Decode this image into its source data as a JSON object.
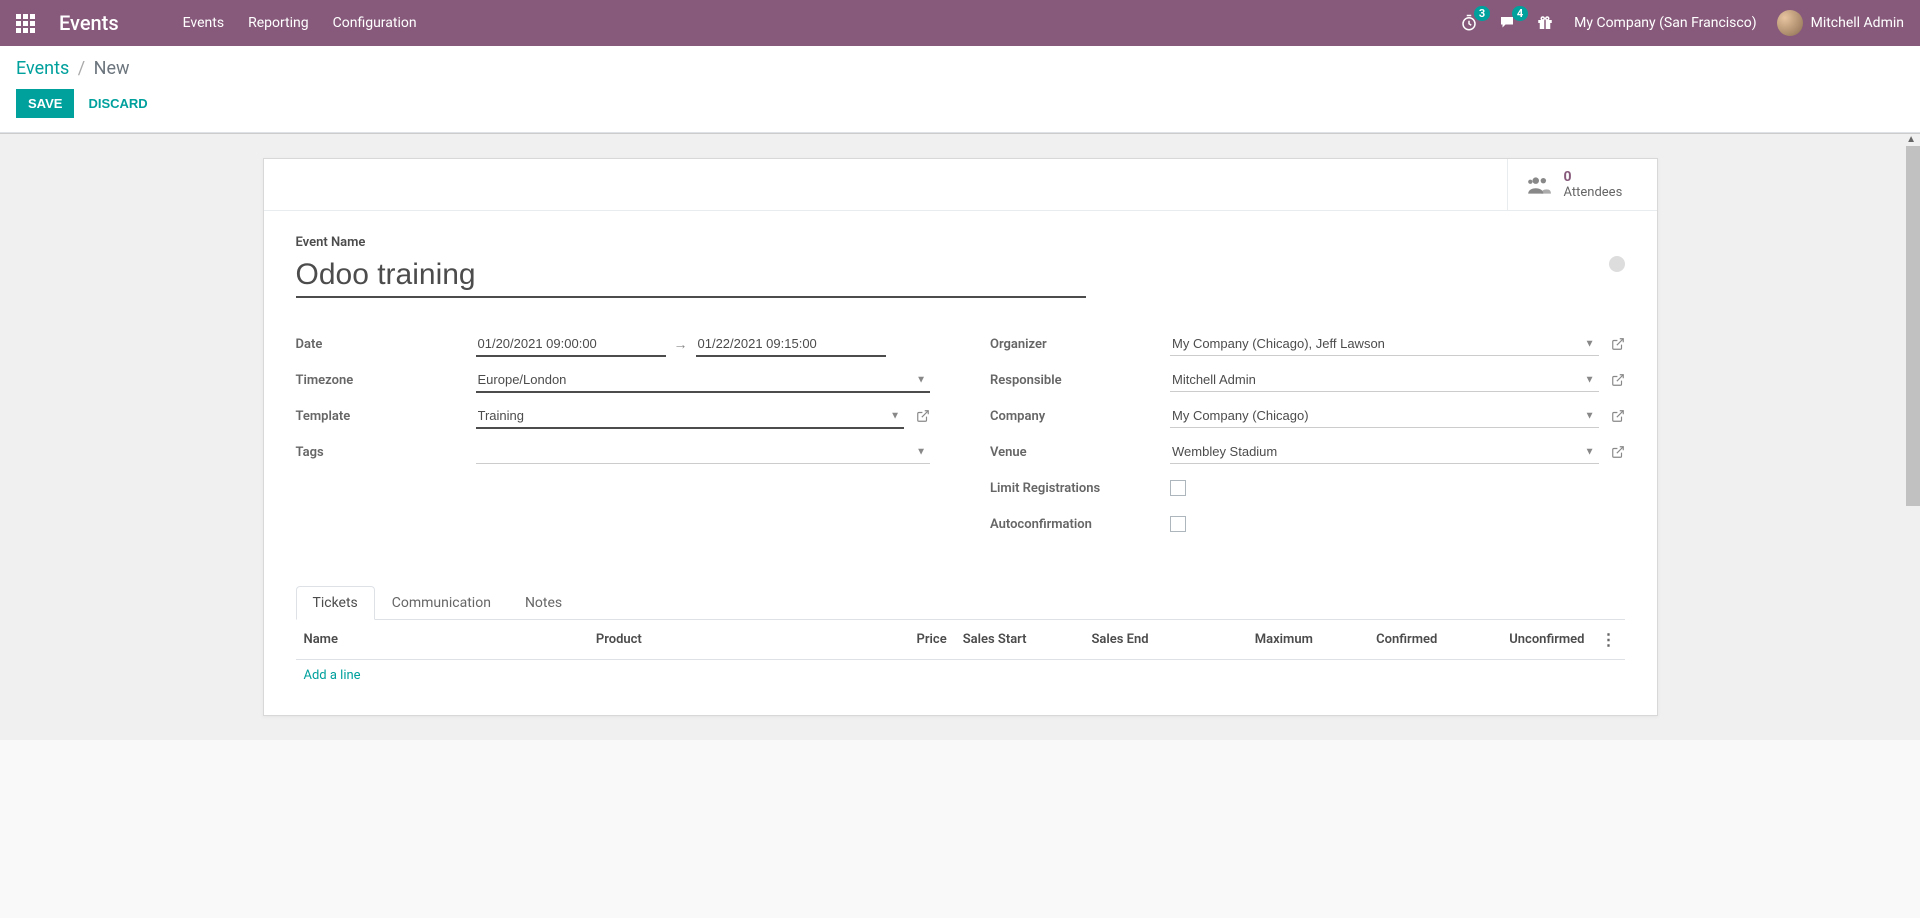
{
  "navbar": {
    "brand": "Events",
    "menu": [
      "Events",
      "Reporting",
      "Configuration"
    ],
    "timer_badge": "3",
    "chat_badge": "4",
    "company": "My Company (San Francisco)",
    "user": "Mitchell Admin"
  },
  "breadcrumb": {
    "root": "Events",
    "active": "New"
  },
  "actions": {
    "save": "Save",
    "discard": "Discard"
  },
  "stats": {
    "attendees_count": "0",
    "attendees_label": "Attendees"
  },
  "form": {
    "event_name_label": "Event Name",
    "event_name": "Odoo training",
    "labels": {
      "date": "Date",
      "timezone": "Timezone",
      "template": "Template",
      "tags": "Tags",
      "organizer": "Organizer",
      "responsible": "Responsible",
      "company": "Company",
      "venue": "Venue",
      "limit": "Limit Registrations",
      "autoconfirm": "Autoconfirmation"
    },
    "date_start": "01/20/2021 09:00:00",
    "date_end": "01/22/2021 09:15:00",
    "timezone": "Europe/London",
    "template": "Training",
    "tags": "",
    "organizer": "My Company (Chicago), Jeff Lawson",
    "responsible": "Mitchell Admin",
    "company": "My Company (Chicago)",
    "venue": "Wembley Stadium"
  },
  "tabs": {
    "tickets": "Tickets",
    "communication": "Communication",
    "notes": "Notes"
  },
  "table": {
    "headers": {
      "name": "Name",
      "product": "Product",
      "price": "Price",
      "sales_start": "Sales Start",
      "sales_end": "Sales End",
      "maximum": "Maximum",
      "confirmed": "Confirmed",
      "unconfirmed": "Unconfirmed"
    },
    "add_line": "Add a line"
  }
}
